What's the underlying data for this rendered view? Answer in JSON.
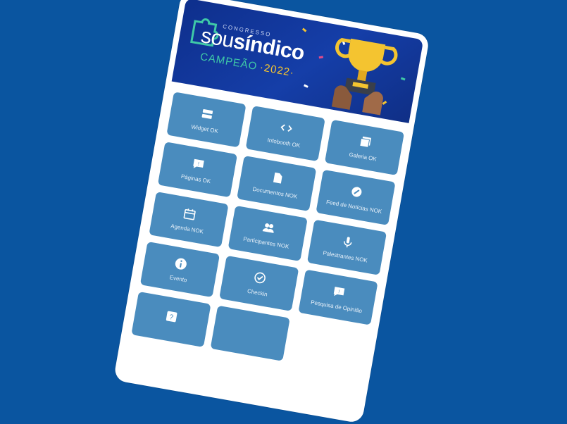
{
  "banner": {
    "kicker": "CONGRESSO",
    "brand_light": "sou",
    "brand_bold": "síndico",
    "subtitle": "CAMPEÃO",
    "year": "·2022·"
  },
  "menu": {
    "items": [
      {
        "label": "Widget OK",
        "icon": "widget-icon"
      },
      {
        "label": "Infobooth OK",
        "icon": "code-icon"
      },
      {
        "label": "Galeria OK",
        "icon": "gallery-icon"
      },
      {
        "label": "Páginas OK",
        "icon": "pages-icon"
      },
      {
        "label": "Documentos NOK",
        "icon": "document-icon"
      },
      {
        "label": "Feed de Notícias NOK",
        "icon": "news-feed-icon"
      },
      {
        "label": "Agenda NOK",
        "icon": "calendar-icon"
      },
      {
        "label": "Participantes NOK",
        "icon": "participants-icon"
      },
      {
        "label": "Palestrantes NOK",
        "icon": "microphone-icon"
      },
      {
        "label": "Evento",
        "icon": "info-icon"
      },
      {
        "label": "Checkin",
        "icon": "check-circle-icon"
      },
      {
        "label": "Pesquisa de Opinião",
        "icon": "survey-icon"
      },
      {
        "label": "",
        "icon": "help-icon"
      },
      {
        "label": "",
        "icon": "blank-icon"
      }
    ]
  },
  "colors": {
    "background": "#0a55a0",
    "tile": "#4a8cbe",
    "accent_green": "#3fc9a7",
    "accent_gold": "#f4c430"
  }
}
